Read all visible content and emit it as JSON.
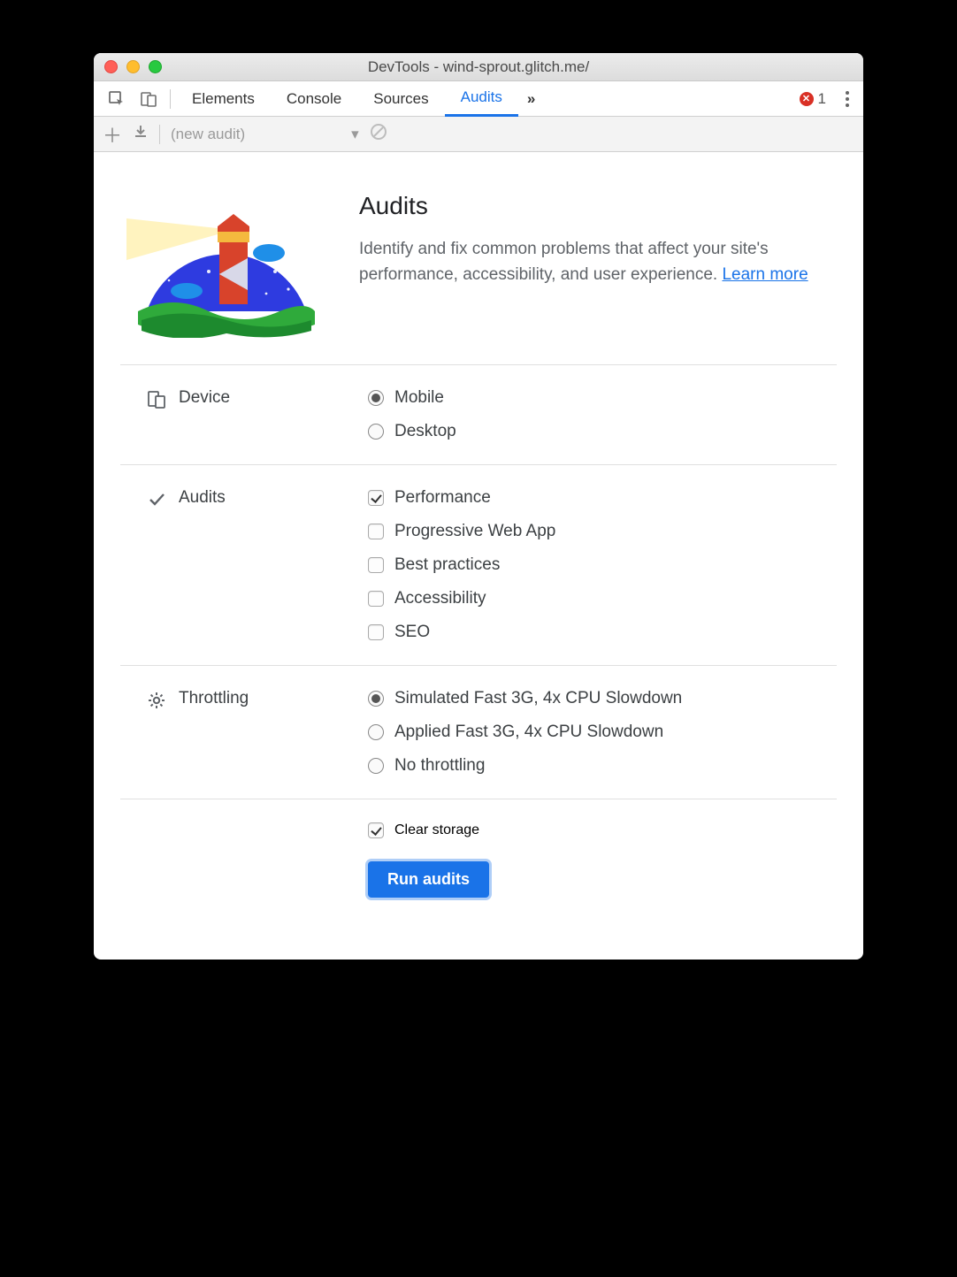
{
  "window": {
    "title": "DevTools - wind-sprout.glitch.me/"
  },
  "tabs": {
    "items": [
      "Elements",
      "Console",
      "Sources",
      "Audits"
    ],
    "active_index": 3,
    "error_count": "1"
  },
  "toolbar": {
    "select_label": "(new audit)"
  },
  "hero": {
    "heading": "Audits",
    "description": "Identify and fix common problems that affect your site's performance, accessibility, and user experience. ",
    "learn_more": "Learn more"
  },
  "sections": {
    "device": {
      "label": "Device",
      "options": [
        {
          "label": "Mobile",
          "selected": true
        },
        {
          "label": "Desktop",
          "selected": false
        }
      ]
    },
    "audits": {
      "label": "Audits",
      "options": [
        {
          "label": "Performance",
          "checked": true
        },
        {
          "label": "Progressive Web App",
          "checked": false
        },
        {
          "label": "Best practices",
          "checked": false
        },
        {
          "label": "Accessibility",
          "checked": false
        },
        {
          "label": "SEO",
          "checked": false
        }
      ]
    },
    "throttling": {
      "label": "Throttling",
      "options": [
        {
          "label": "Simulated Fast 3G, 4x CPU Slowdown",
          "selected": true
        },
        {
          "label": "Applied Fast 3G, 4x CPU Slowdown",
          "selected": false
        },
        {
          "label": "No throttling",
          "selected": false
        }
      ]
    },
    "clear_storage": {
      "label": "Clear storage",
      "checked": true
    }
  },
  "run_button": "Run audits"
}
